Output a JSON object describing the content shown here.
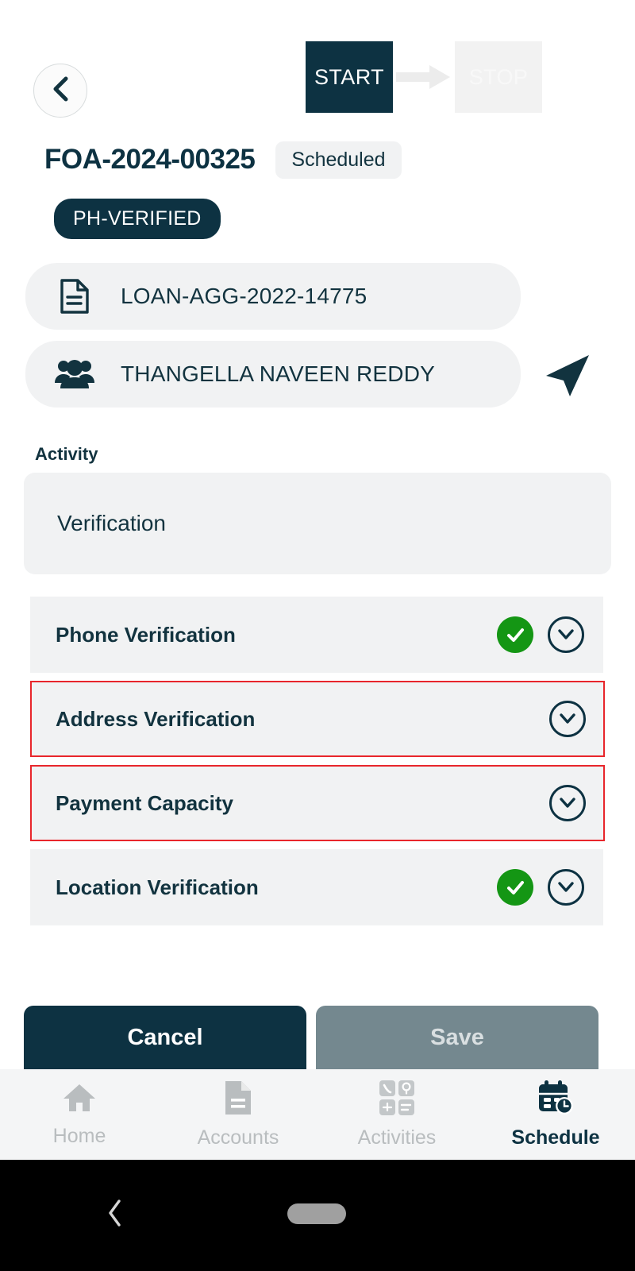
{
  "header": {
    "back_icon": "chevron-left-icon",
    "start_label": "START",
    "stop_label": "STOP",
    "arrow_icon": "arrow-right-icon",
    "start_bg": "#0d3242",
    "stop_bg": "#f2f2f2"
  },
  "case": {
    "id": "FOA-2024-00325",
    "status": "Scheduled",
    "badge": "PH-VERIFIED",
    "badge_bg": "#0d3242"
  },
  "info": {
    "loan": {
      "icon": "document-icon",
      "value": "LOAN-AGG-2022-14775"
    },
    "customer": {
      "icon": "people-group-icon",
      "value": "THANGELLA NAVEEN REDDY",
      "nav_icon": "navigation-arrow-icon"
    }
  },
  "activity": {
    "label": "Activity",
    "value": "Verification"
  },
  "verifications": [
    {
      "label": "Phone Verification",
      "verified": true,
      "flagged": false,
      "chevron": "chevron-down-icon",
      "check": "check-icon"
    },
    {
      "label": "Address Verification",
      "verified": false,
      "flagged": true,
      "chevron": "chevron-down-icon"
    },
    {
      "label": "Payment Capacity",
      "verified": false,
      "flagged": true,
      "chevron": "chevron-down-icon"
    },
    {
      "label": "Location Verification",
      "verified": true,
      "flagged": false,
      "chevron": "chevron-down-icon",
      "check": "check-icon"
    }
  ],
  "colors": {
    "flag_border": "#e8262b",
    "verified_green": "#149614",
    "primary_navy": "#0d3242",
    "card_bg": "#f1f2f3"
  },
  "actions": {
    "cancel_label": "Cancel",
    "save_label": "Save"
  },
  "bottom_nav": [
    {
      "label": "Home",
      "icon": "home-icon",
      "active": false
    },
    {
      "label": "Accounts",
      "icon": "document-icon",
      "active": false
    },
    {
      "label": "Activities",
      "icon": "grid-apps-icon",
      "active": false
    },
    {
      "label": "Schedule",
      "icon": "calendar-clock-icon",
      "active": true
    }
  ],
  "system_bar": {
    "back_icon": "system-back-icon",
    "home_pill": "system-home-pill"
  }
}
